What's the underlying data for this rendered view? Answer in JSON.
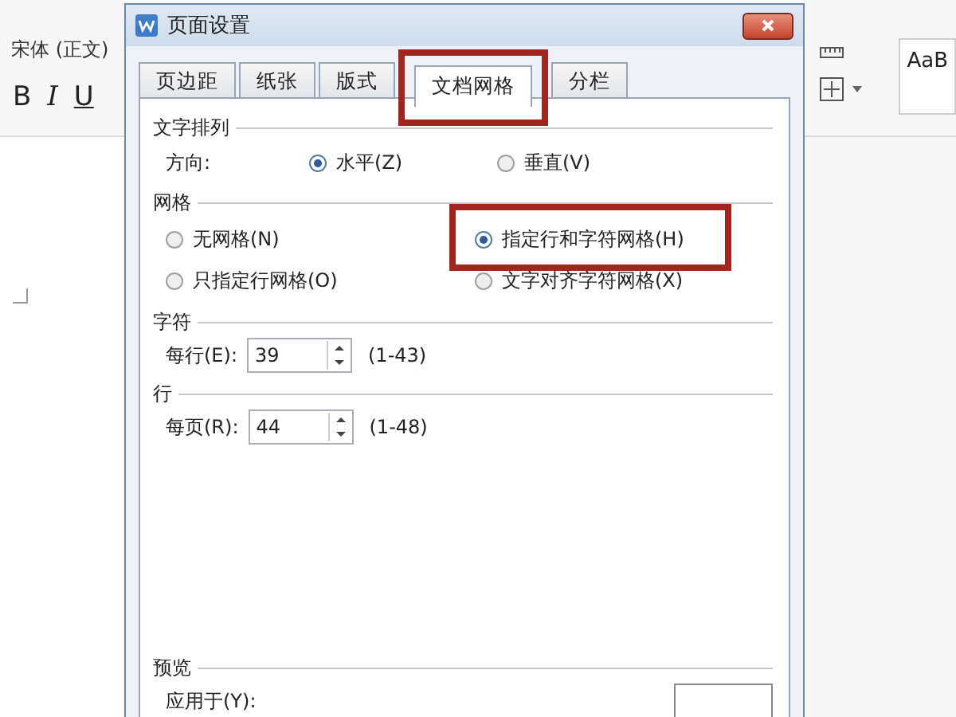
{
  "editor": {
    "font_field": {
      "value": "宋体 (正文)"
    },
    "format_buttons": [
      {
        "label": "B",
        "kind": "bold"
      },
      {
        "label": "I",
        "kind": "italic"
      },
      {
        "label": "U",
        "kind": "underline"
      }
    ],
    "style_preview": "AaB"
  },
  "dialog": {
    "title": "页面设置",
    "tabs": [
      {
        "label": "页边距",
        "selected": false,
        "highlighted": false
      },
      {
        "label": "纸张",
        "selected": false,
        "highlighted": false
      },
      {
        "label": "版式",
        "selected": false,
        "highlighted": false
      },
      {
        "label": "文档网格",
        "selected": true,
        "highlighted": true
      },
      {
        "label": "分栏",
        "selected": false,
        "highlighted": false
      }
    ],
    "text_direction": {
      "heading": "文字排列",
      "label": "方向:",
      "options": [
        {
          "label": "水平(Z)",
          "selected": true
        },
        {
          "label": "垂直(V)",
          "selected": false
        }
      ]
    },
    "grid": {
      "heading": "网格",
      "options": [
        {
          "label": "无网格(N)",
          "selected": false,
          "highlighted": false
        },
        {
          "label": "指定行和字符网格(H)",
          "selected": true,
          "highlighted": true
        },
        {
          "label": "只指定行网格(O)",
          "selected": false,
          "highlighted": false
        },
        {
          "label": "文字对齐字符网格(X)",
          "selected": false,
          "highlighted": false
        }
      ]
    },
    "characters": {
      "heading": "字符",
      "label": "每行(E):",
      "value": "39",
      "range": "(1-43)"
    },
    "lines": {
      "heading": "行",
      "label": "每页(R):",
      "value": "44",
      "range": "(1-48)"
    },
    "preview": {
      "heading": "预览",
      "apply_label": "应用于(Y):"
    }
  }
}
